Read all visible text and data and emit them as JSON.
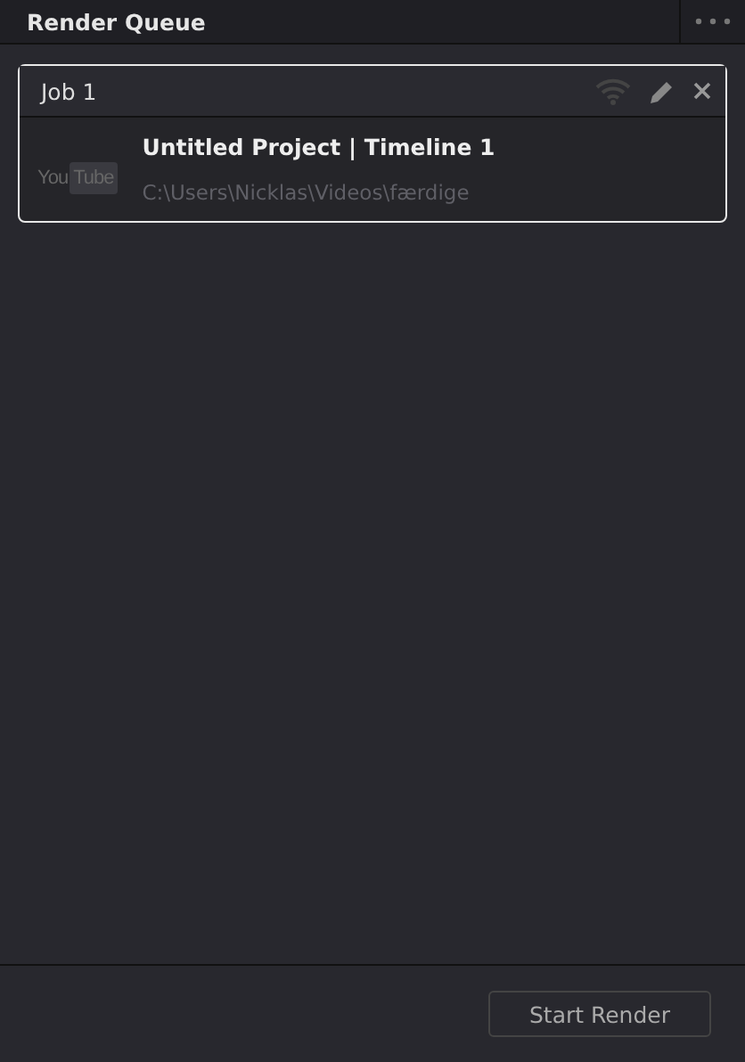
{
  "panel": {
    "title": "Render Queue"
  },
  "jobs": [
    {
      "name": "Job 1",
      "selected": true,
      "logo": {
        "left": "You",
        "right": "Tube"
      },
      "title": "Untitled Project | Timeline 1",
      "path": "C:\\Users\\Nicklas\\Videos\\færdige"
    }
  ],
  "footer": {
    "button": "Start Render"
  }
}
